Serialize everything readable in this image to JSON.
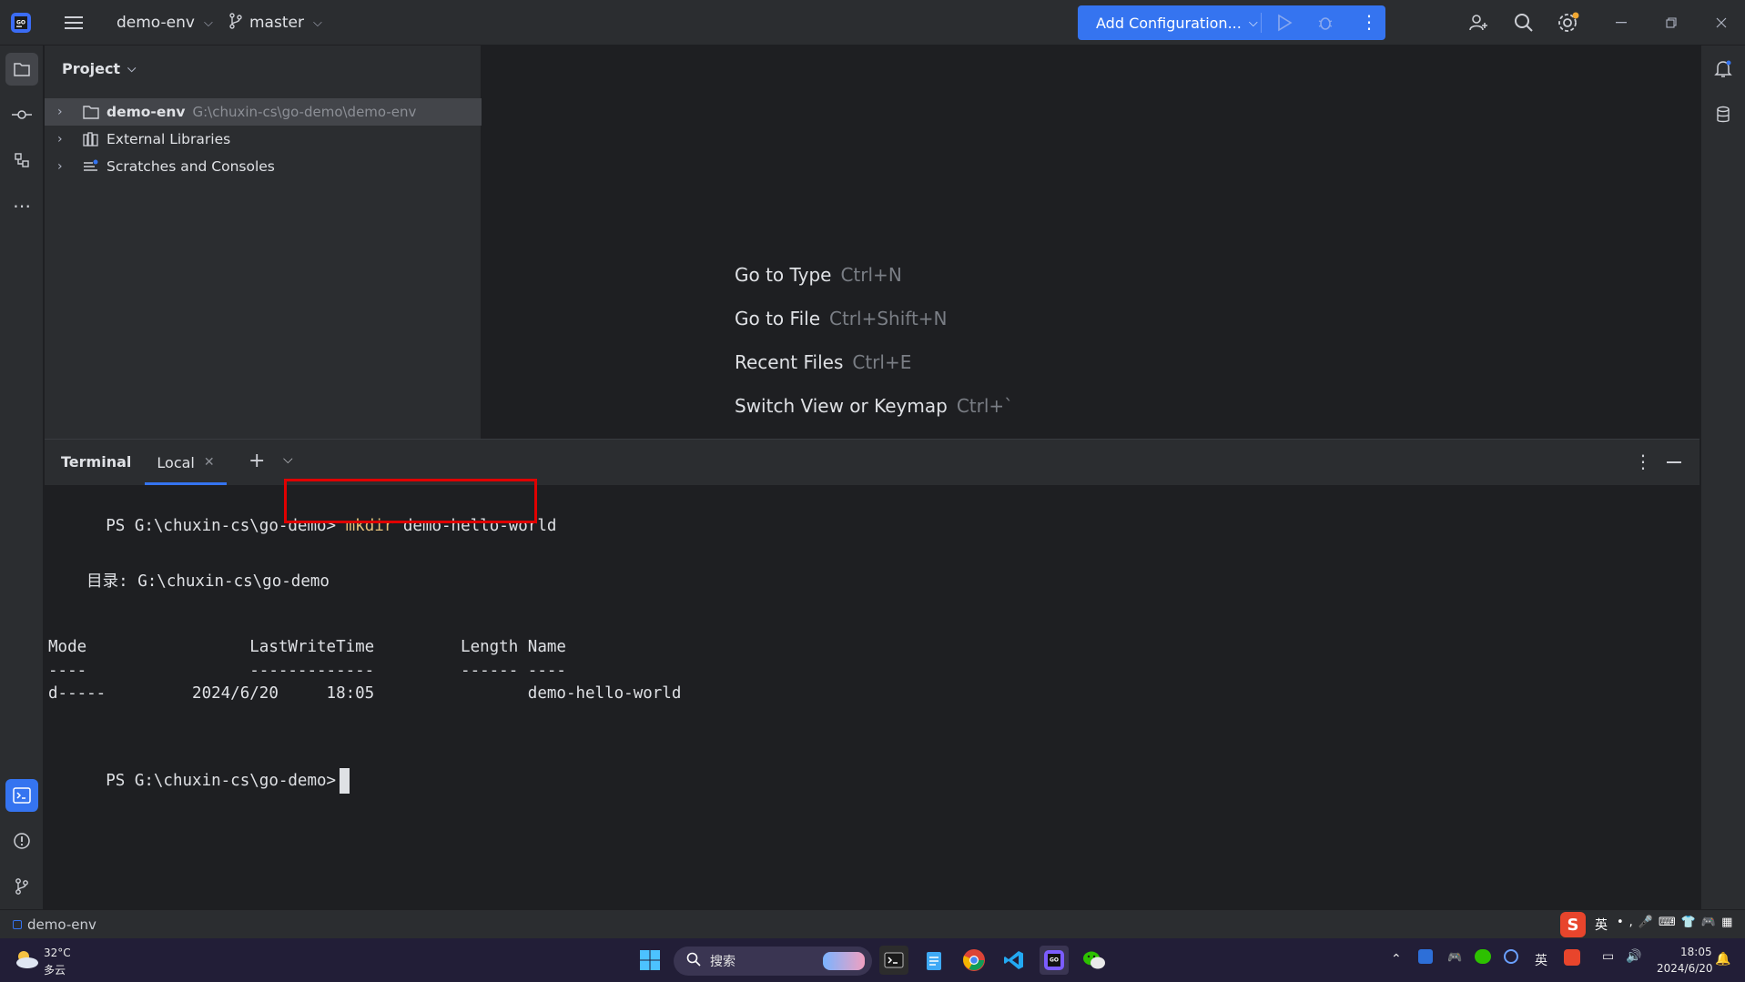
{
  "titlebar": {
    "project": "demo-env",
    "branch": "master",
    "run_config": "Add Configuration..."
  },
  "project_panel": {
    "title": "Project",
    "items": [
      {
        "label": "demo-env",
        "hint": "G:\\chuxin-cs\\go-demo\\demo-env"
      },
      {
        "label": "External Libraries"
      },
      {
        "label": "Scratches and Consoles"
      }
    ]
  },
  "editor_hints": [
    {
      "label": "Go to Type",
      "shortcut": "Ctrl+N"
    },
    {
      "label": "Go to File",
      "shortcut": "Ctrl+Shift+N"
    },
    {
      "label": "Recent Files",
      "shortcut": "Ctrl+E"
    },
    {
      "label": "Switch View or Keymap",
      "shortcut": "Ctrl+`"
    }
  ],
  "terminal": {
    "title": "Terminal",
    "tab": "Local",
    "prompt": "PS G:\\chuxin-cs\\go-demo>",
    "cmd_keyword": "mkdir",
    "cmd_arg": "demo-hello-world",
    "dir_line": "    目录: G:\\chuxin-cs\\go-demo",
    "header_line": "Mode                 LastWriteTime         Length Name",
    "sep_line": "----                 -------------         ------ ----",
    "row_line": "d-----         2024/6/20     18:05                demo-hello-world",
    "prompt2": "PS G:\\chuxin-cs\\go-demo>"
  },
  "statusbar": {
    "project": "demo-env"
  },
  "taskbar": {
    "weather_temp": "32°C",
    "weather_desc": "多云",
    "search_placeholder": "搜索",
    "ime": "英",
    "ime_tray": "英",
    "time": "18:05",
    "date": "2024/6/20"
  },
  "colors": {
    "accent": "#3574f0",
    "highlight_box": "#e00000",
    "keyword": "#e5c07b"
  }
}
